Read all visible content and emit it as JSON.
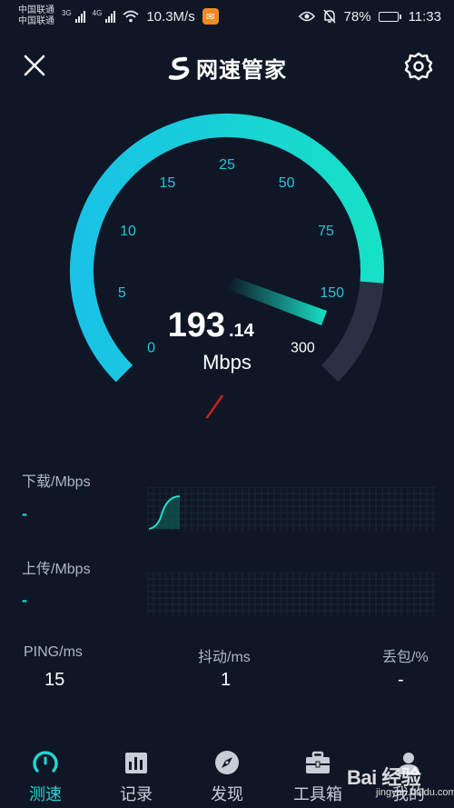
{
  "status_bar": {
    "carrier_1": "中国联通",
    "carrier_2": "中国联通",
    "net_1": "3G",
    "net_2": "4G",
    "speed": "10.3M/s",
    "battery": "78%",
    "battery_level": 0.78,
    "time": "11:33"
  },
  "header": {
    "title": "网速管家"
  },
  "gauge": {
    "ticks": [
      "0",
      "5",
      "10",
      "15",
      "25",
      "50",
      "75",
      "150",
      "300"
    ],
    "value_int": "193",
    "value_dec": ".14",
    "unit": "Mbps",
    "progress_fraction": 0.85,
    "colors": {
      "start": "#19c2e6",
      "end": "#17e1c6",
      "track": "#2a3142",
      "tick_text": "#21c7d8"
    }
  },
  "download": {
    "label": "下载/Mbps",
    "value": "-"
  },
  "upload": {
    "label": "上传/Mbps",
    "value": "-"
  },
  "stats": {
    "ping": {
      "label": "PING/ms",
      "value": "15"
    },
    "jitter": {
      "label": "抖动/ms",
      "value": "1"
    },
    "loss": {
      "label": "丢包/%",
      "value": "-"
    }
  },
  "nav": [
    {
      "label": "测速",
      "icon": "gauge-icon",
      "active": true
    },
    {
      "label": "记录",
      "icon": "bar-chart-icon",
      "active": false
    },
    {
      "label": "发现",
      "icon": "compass-icon",
      "active": false
    },
    {
      "label": "工具箱",
      "icon": "toolbox-icon",
      "active": false
    },
    {
      "label": "我的",
      "icon": "user-icon",
      "active": false
    }
  ],
  "watermark": {
    "brand": "Bai 经验",
    "url": "jingyan.baidu.com"
  }
}
